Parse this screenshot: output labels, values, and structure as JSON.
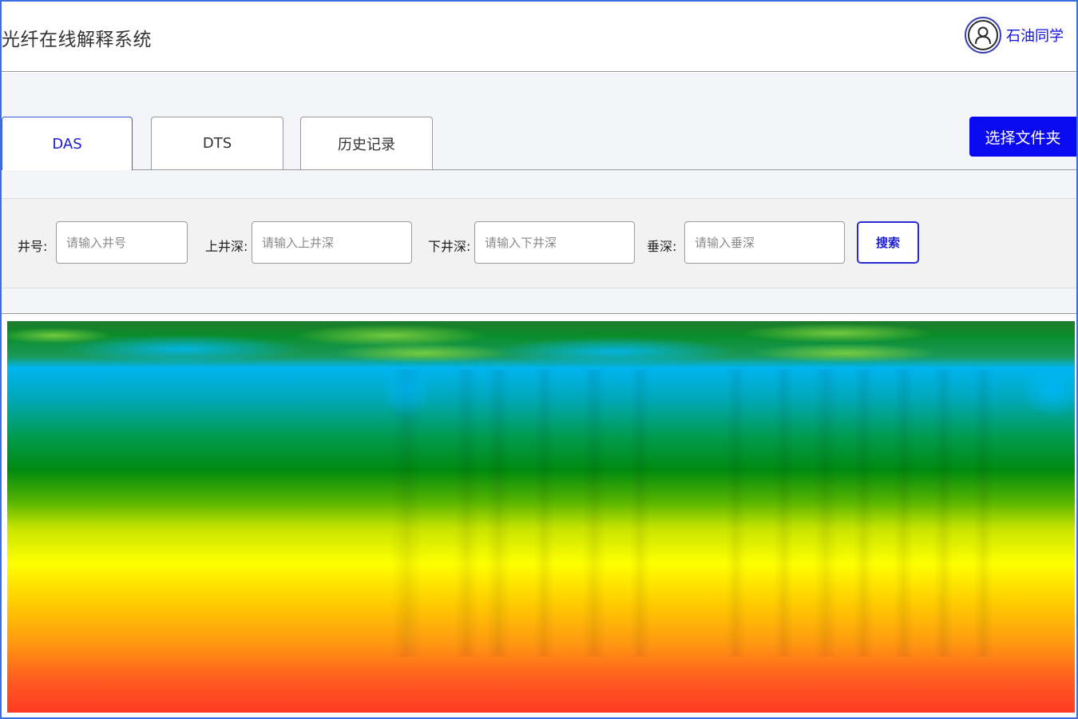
{
  "header": {
    "title": "光纤在线解释系统",
    "user_name": "石油同学"
  },
  "tabs": [
    {
      "label": "DAS",
      "active": true
    },
    {
      "label": "DTS",
      "active": false
    },
    {
      "label": "历史记录",
      "active": false
    }
  ],
  "toolbar": {
    "select_folder_label": "选择文件夹"
  },
  "search": {
    "well_label": "井号:",
    "well_placeholder": "请输入井号",
    "upper_label": "上井深:",
    "upper_placeholder": "请输入上井深",
    "lower_label": "下井深:",
    "lower_placeholder": "请输入下井深",
    "vertical_label": "垂深:",
    "vertical_placeholder": "请输入垂深",
    "search_button": "搜索"
  },
  "colors": {
    "accent": "#0a0af0",
    "link": "#1a1ad8"
  }
}
